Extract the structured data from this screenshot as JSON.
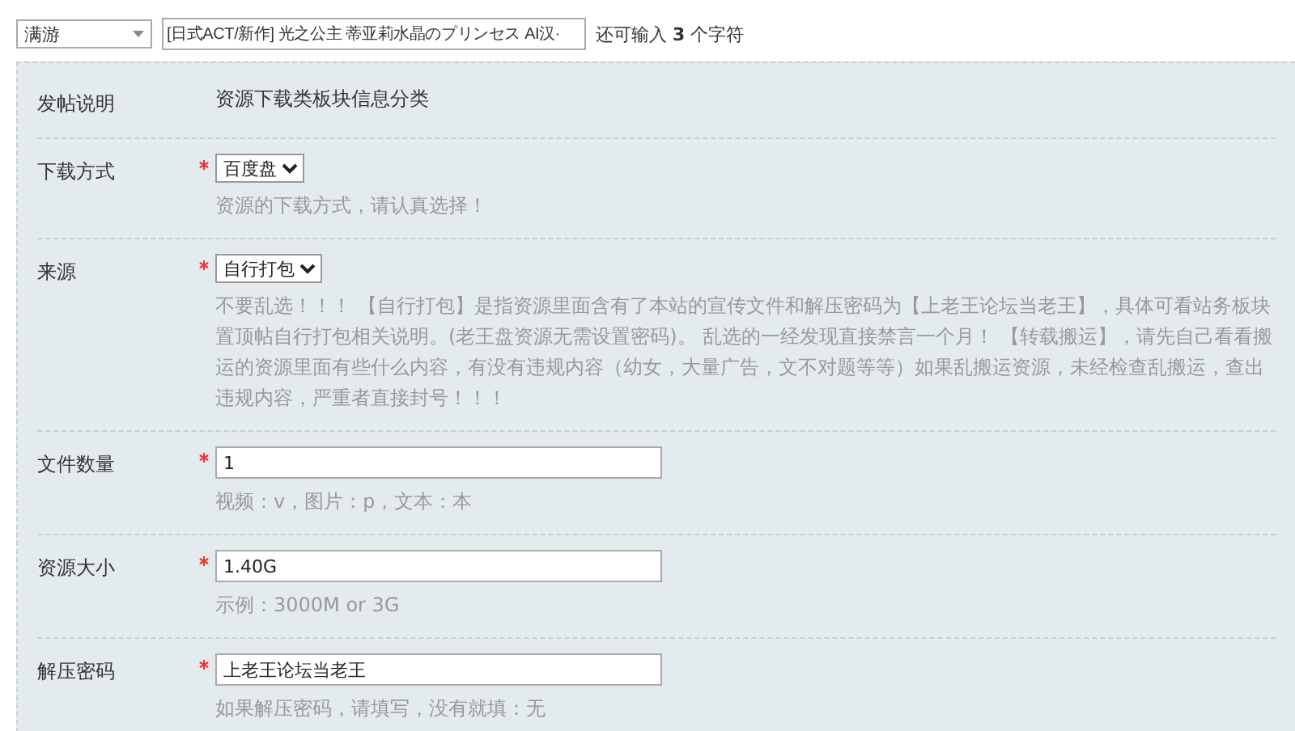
{
  "top_bar": {
    "category_select": {
      "value": "满游"
    },
    "title_field": {
      "value": "[日式ACT/新作] 光之公主 蒂亚莉水晶のプリンセス AI汉·"
    },
    "remaining_hint": "还可输入 **3** 个字符"
  },
  "form_rows": [
    {
      "label": "发帖说明",
      "required": false,
      "control": {
        "kind": "text",
        "value": "资源下载类板块信息分类"
      },
      "hint_lines": []
    },
    {
      "label": "下载方式",
      "required": true,
      "control": {
        "kind": "select",
        "value": "百度盘"
      },
      "hint_lines": [
        "资源的下载方式，请认真选择！"
      ]
    },
    {
      "label": "来源",
      "required": true,
      "control": {
        "kind": "select",
        "value": "自行打包"
      },
      "hint_lines": [
        "不要乱选！！！ 【自行打包】是指资源里面含有了本站的宣传文件和解压密码为【上老王论坛当老王】，具体可看站务板块",
        "置顶帖自行打包相关说明。(老王盘资源无需设置密码)。 乱选的一经发现直接禁言一个月！ 【转载搬运】，请先自己看看搬",
        "运的资源里面有些什么内容，有没有违规内容（幼女，大量广告，文不对题等等）如果乱搬运资源，未经检查乱搬运，查出",
        "违规内容，严重者直接封号！！！"
      ]
    },
    {
      "label": "文件数量",
      "required": true,
      "control": {
        "kind": "input",
        "value": "1"
      },
      "hint_lines": [
        "视频：v，图片：p，文本：本"
      ]
    },
    {
      "label": "资源大小",
      "required": true,
      "control": {
        "kind": "input",
        "value": "1.40G"
      },
      "hint_lines": [
        "示例：3000M or 3G"
      ]
    },
    {
      "label": "解压密码",
      "required": true,
      "control": {
        "kind": "input",
        "value": "上老王论坛当老王"
      },
      "hint_lines": [
        "如果解压密码，请填写，没有就填：无"
      ]
    }
  ]
}
